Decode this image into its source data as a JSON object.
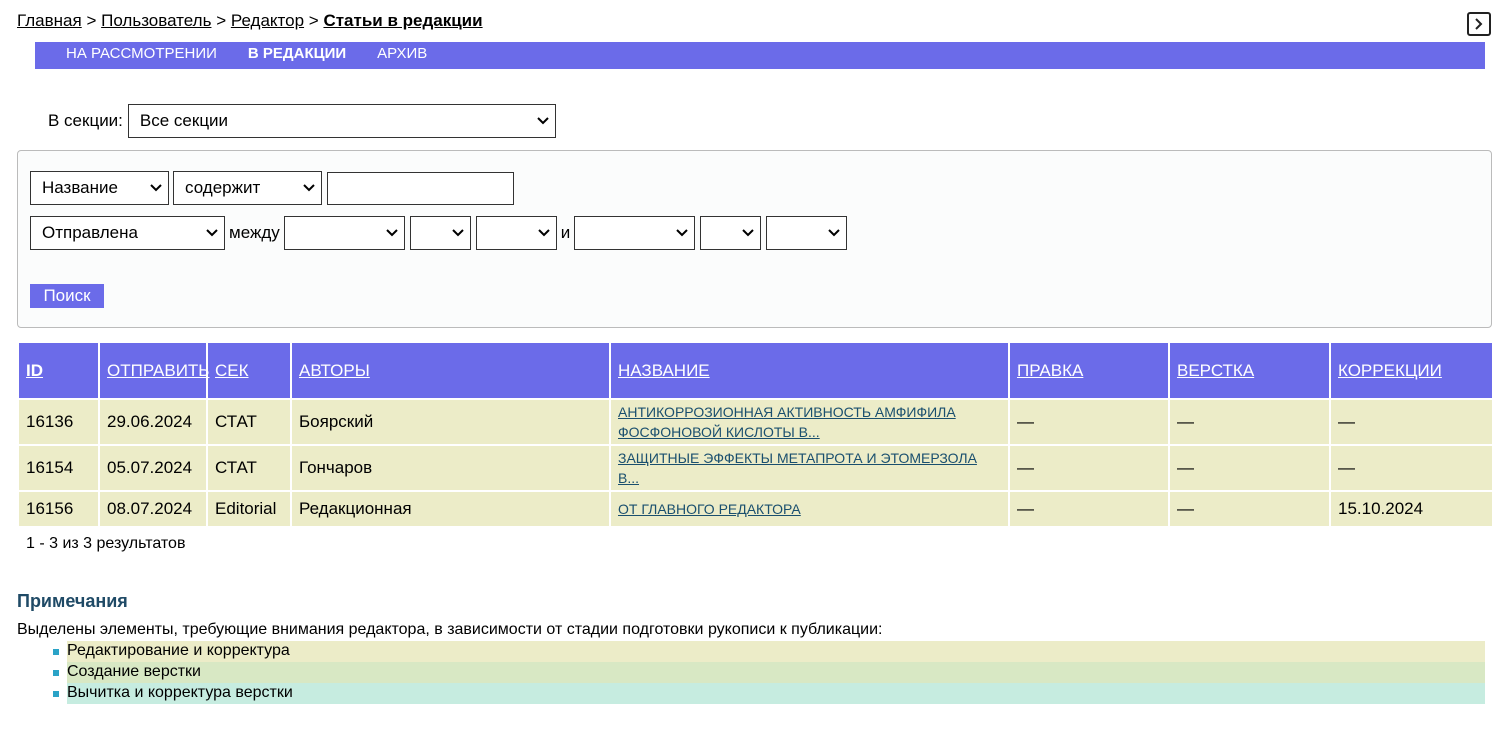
{
  "breadcrumb": {
    "items": [
      "Главная",
      "Пользователь",
      "Редактор"
    ],
    "separator": ">",
    "current": "Статьи в редакции"
  },
  "nav": {
    "tabs": [
      {
        "label": "НА РАССМОТРЕНИИ",
        "active": false
      },
      {
        "label": "В РЕДАКЦИИ",
        "active": true
      },
      {
        "label": "АРХИВ",
        "active": false
      }
    ]
  },
  "section_filter": {
    "label": "В секции:",
    "value": "Все секции"
  },
  "search": {
    "field": "Название",
    "operator": "содержит",
    "query": "",
    "date_field": "Отправлена",
    "between_label": "между",
    "and_label": "и",
    "button_label": "Поиск"
  },
  "table": {
    "headers": [
      "ID",
      "ОТПРАВИТЬ",
      "СЕК",
      "АВТОРЫ",
      "НАЗВАНИЕ",
      "ПРАВКА",
      "ВЕРСТКА",
      "КОРРЕКЦИИ"
    ],
    "rows": [
      {
        "id": "16136",
        "date": "29.06.2024",
        "section": "СТАТ",
        "authors": "Боярский",
        "title": "АНТИКОРРОЗИОННАЯ АКТИВНОСТЬ АМФИФИЛА ФОСФОНОВОЙ КИСЛОТЫ В...",
        "edit": "—",
        "layout": "—",
        "corrections": "—"
      },
      {
        "id": "16154",
        "date": "05.07.2024",
        "section": "СТАТ",
        "authors": "Гончаров",
        "title": "ЗАЩИТНЫЕ ЭФФЕКТЫ МЕТАПРОТА И ЭТОМЕРЗОЛА В...",
        "edit": "—",
        "layout": "—",
        "corrections": "—"
      },
      {
        "id": "16156",
        "date": "08.07.2024",
        "section": "Editorial",
        "authors": "Редакционная",
        "title": "ОТ ГЛАВНОГО РЕДАКТОРА",
        "edit": "—",
        "layout": "—",
        "corrections": "15.10.2024"
      }
    ]
  },
  "results_count": {
    "range": "1 - 3",
    "text": " из 3 результатов"
  },
  "notes": {
    "heading": "Примечания",
    "text": "Выделены элементы, требующие внимания редактора, в зависимости от стадии подготовки рукописи к публикации:",
    "legend": [
      {
        "label": "Редактирование и корректура",
        "color": "#ececc8"
      },
      {
        "label": "Создание верстки",
        "color": "#d8e8c4"
      },
      {
        "label": "Вычитка и корректура верстки",
        "color": "#c6ece0"
      }
    ]
  },
  "colors": {
    "accent": "#6b6be9",
    "row_bg": "#ececc8",
    "heading": "#1f4a66",
    "bullet": "#2aa3c7"
  }
}
